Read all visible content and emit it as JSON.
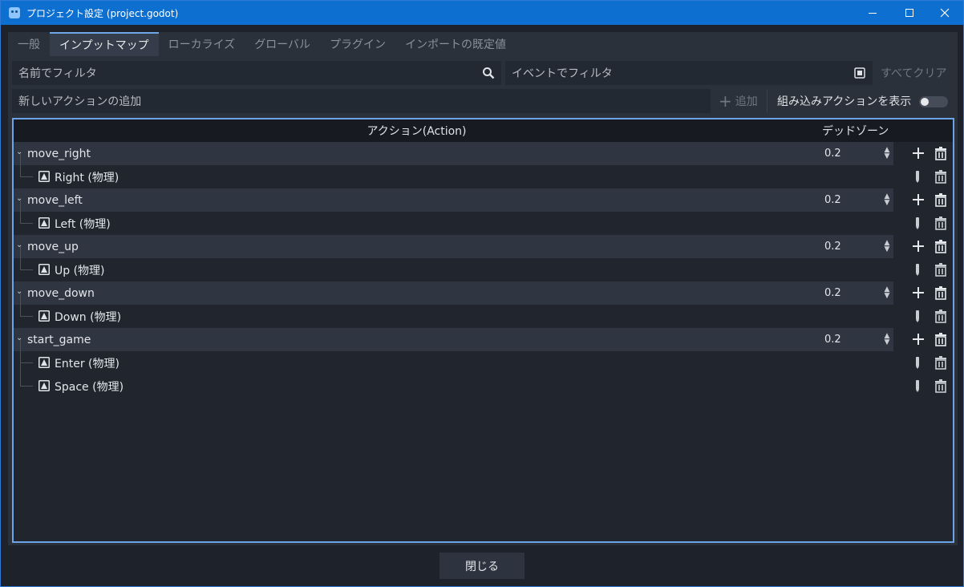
{
  "window": {
    "title": "プロジェクト設定 (project.godot)"
  },
  "tabs": [
    {
      "label": "一般"
    },
    {
      "label": "インプットマップ"
    },
    {
      "label": "ローカライズ"
    },
    {
      "label": "グローバル"
    },
    {
      "label": "プラグイン"
    },
    {
      "label": "インポートの既定値"
    }
  ],
  "active_tab": "インプットマップ",
  "filters": {
    "name_placeholder": "名前でフィルタ",
    "event_placeholder": "イベントでフィルタ",
    "clear_all": "すべてクリア"
  },
  "new_action": {
    "placeholder": "新しいアクションの追加",
    "add_label": "追加",
    "builtin_label": "組み込みアクションを表示",
    "builtin_enabled": false
  },
  "tree": {
    "header_action": "アクション(Action)",
    "header_deadzone": "デッドゾーン",
    "actions": [
      {
        "name": "move_right",
        "deadzone": "0.2",
        "events": [
          "Right (物理)"
        ]
      },
      {
        "name": "move_left",
        "deadzone": "0.2",
        "events": [
          "Left (物理)"
        ]
      },
      {
        "name": "move_up",
        "deadzone": "0.2",
        "events": [
          "Up (物理)"
        ]
      },
      {
        "name": "move_down",
        "deadzone": "0.2",
        "events": [
          "Down (物理)"
        ]
      },
      {
        "name": "start_game",
        "deadzone": "0.2",
        "events": [
          "Enter (物理)",
          "Space (物理)"
        ]
      }
    ]
  },
  "footer": {
    "close_label": "閉じる"
  },
  "colors": {
    "accent": "#6ba4e8",
    "titlebar": "#0d6fd0"
  }
}
